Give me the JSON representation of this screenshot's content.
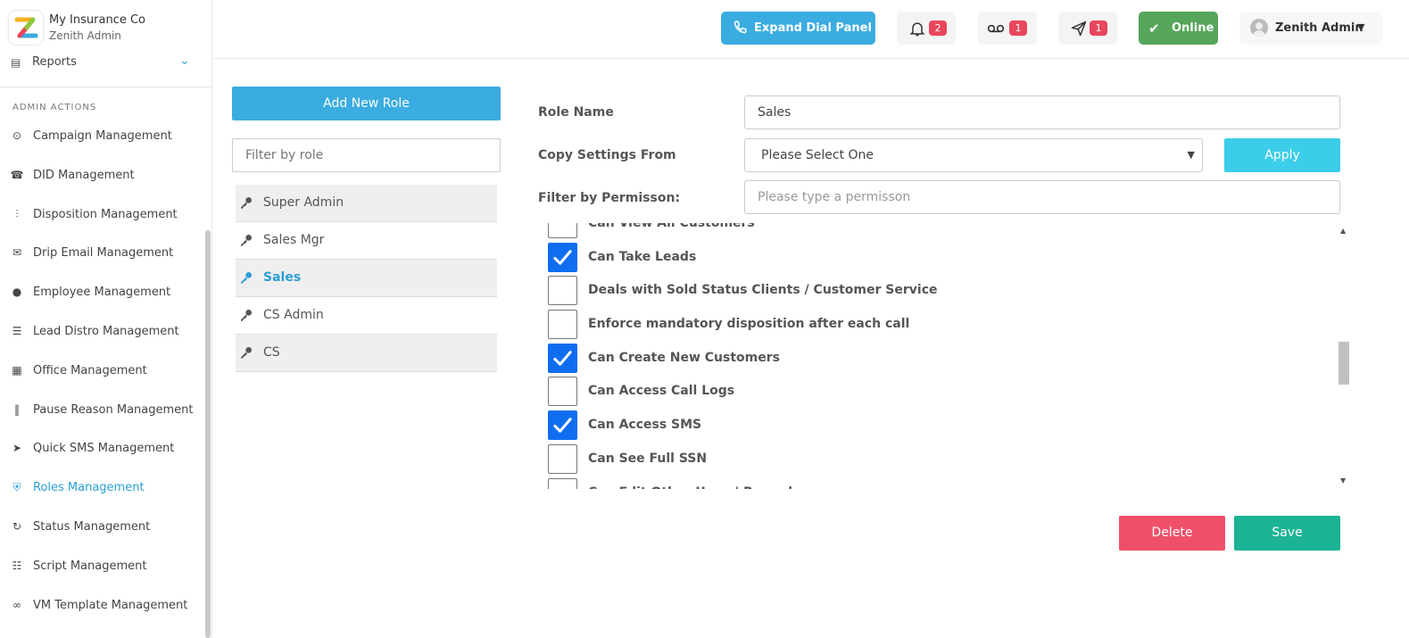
{
  "brand": {
    "name": "My Insurance Co",
    "subtitle": "Zenith Admin"
  },
  "sidebar": {
    "reports_label": "Reports",
    "section_title": "ADMIN ACTIONS",
    "items": [
      {
        "label": "Campaign Management",
        "icon": "broadcast-icon"
      },
      {
        "label": "DID Management",
        "icon": "phone-icon"
      },
      {
        "label": "Disposition Management",
        "icon": "sliders-icon"
      },
      {
        "label": "Drip Email Management",
        "icon": "email-icon"
      },
      {
        "label": "Employee Management",
        "icon": "user-icon"
      },
      {
        "label": "Lead Distro Management",
        "icon": "traffic-light-icon"
      },
      {
        "label": "Office Management",
        "icon": "building-icon"
      },
      {
        "label": "Pause Reason Management",
        "icon": "pause-icon"
      },
      {
        "label": "Quick SMS Management",
        "icon": "send-icon"
      },
      {
        "label": "Roles Management",
        "icon": "shield-icon",
        "active": true
      },
      {
        "label": "Status Management",
        "icon": "refresh-icon"
      },
      {
        "label": "Script Management",
        "icon": "document-icon"
      },
      {
        "label": "VM Template Management",
        "icon": "voicemail-icon"
      }
    ]
  },
  "header": {
    "dial_label": "Expand Dial Panel",
    "notifications_count": "2",
    "voicemail_count": "1",
    "messages_count": "1",
    "status_label": "Online",
    "user_name": "Zenith Admin"
  },
  "roles": {
    "add_label": "Add New Role",
    "filter_placeholder": "Filter by role",
    "items": [
      {
        "label": "Super Admin"
      },
      {
        "label": "Sales Mgr"
      },
      {
        "label": "Sales",
        "active": true
      },
      {
        "label": "CS Admin"
      },
      {
        "label": "CS"
      }
    ]
  },
  "form": {
    "role_name_label": "Role Name",
    "role_name_value": "Sales",
    "copy_label": "Copy Settings From",
    "copy_value": "Please Select One",
    "apply_label": "Apply",
    "filter_perm_label": "Filter by Permisson:",
    "filter_perm_placeholder": "Please type a permisson",
    "permissions": [
      {
        "label": "Can View All Customers",
        "checked": false
      },
      {
        "label": "Can Take Leads",
        "checked": true
      },
      {
        "label": "Deals with Sold Status Clients / Customer Service",
        "checked": false
      },
      {
        "label": "Enforce mandatory disposition after each call",
        "checked": false
      },
      {
        "label": "Can Create New Customers",
        "checked": true
      },
      {
        "label": "Can Access Call Logs",
        "checked": false
      },
      {
        "label": "Can Access SMS",
        "checked": true
      },
      {
        "label": "Can See Full SSN",
        "checked": false
      },
      {
        "label": "Can Edit Other Users' Records",
        "checked": false
      }
    ],
    "delete_label": "Delete",
    "save_label": "Save"
  },
  "colors": {
    "primary": "#3aace0",
    "active_text": "#2a9fd6",
    "badge": "#e8465c",
    "online": "#55a55a",
    "delete": "#ef5067",
    "save": "#1bb394",
    "apply": "#3bcde9",
    "checkbox": "#0f6ef0"
  }
}
